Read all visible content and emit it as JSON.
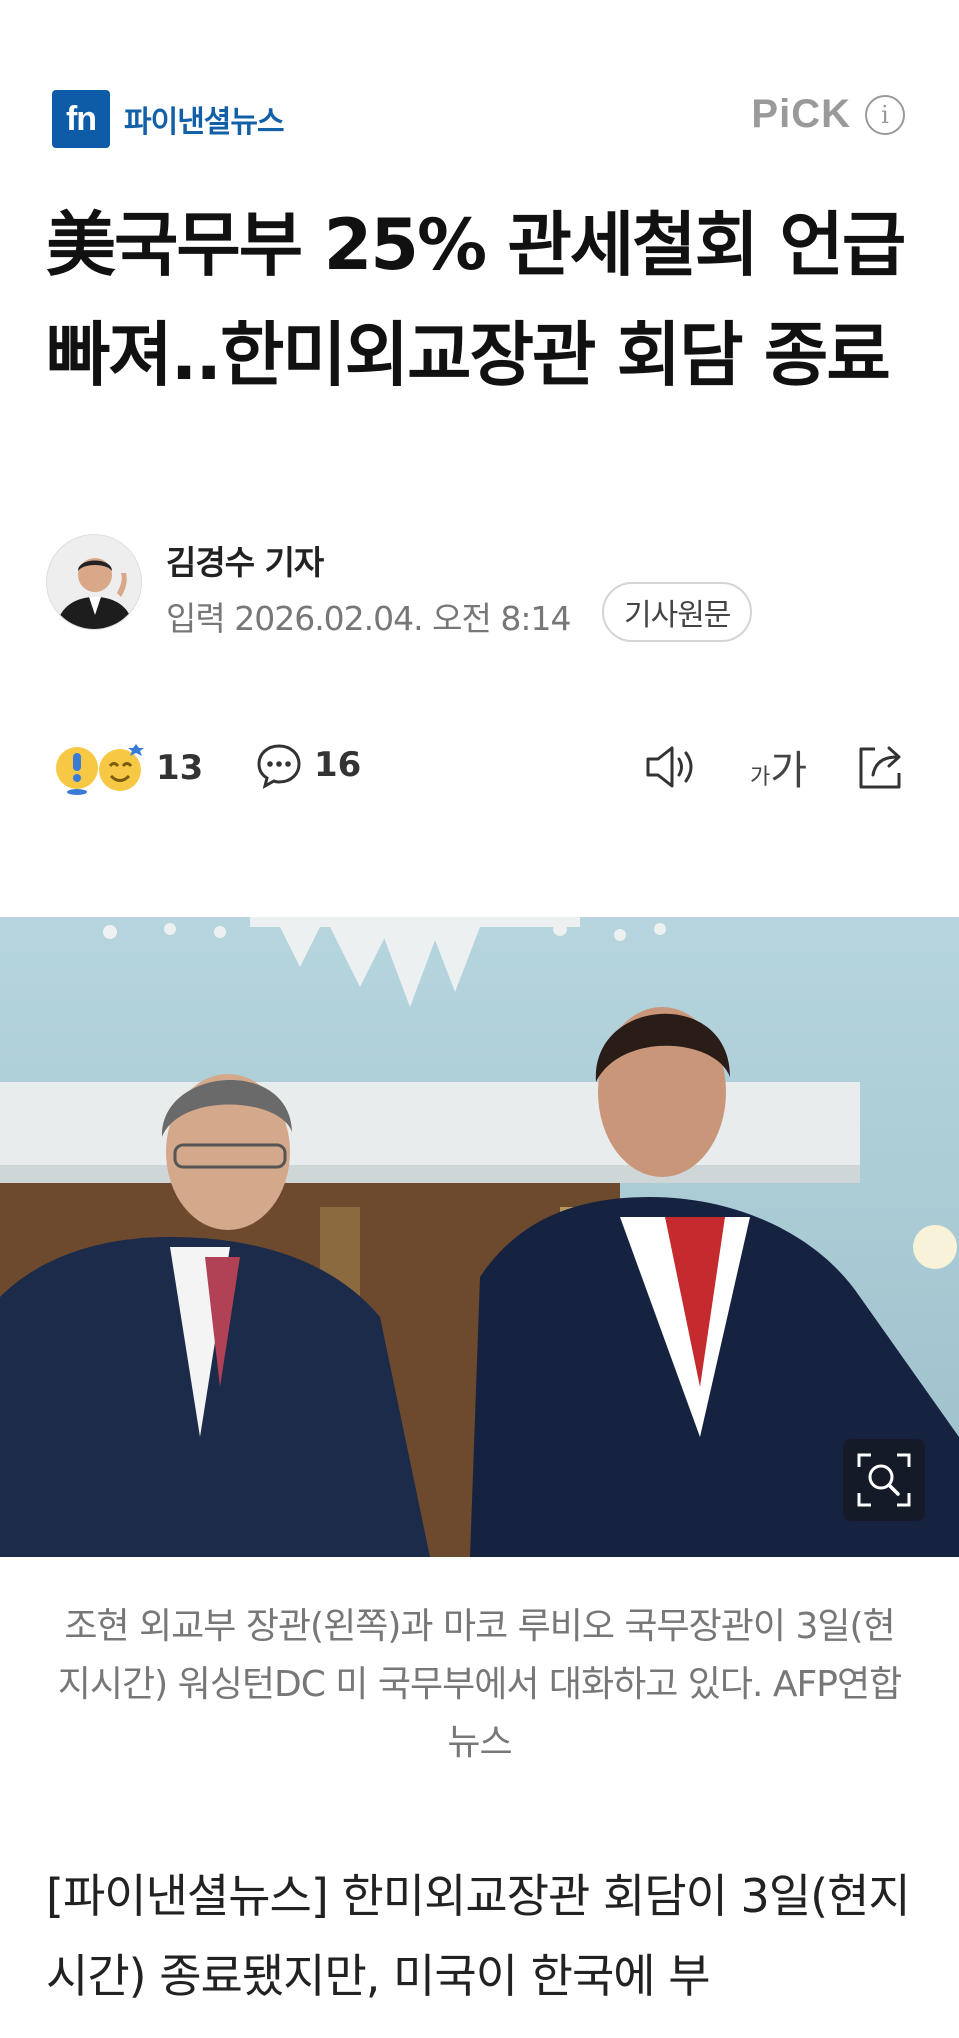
{
  "header": {
    "logo_mark": "fn",
    "logo_text": "파이낸셜뉴스",
    "pick_label": "PiCK",
    "info_icon": "info-circle-icon",
    "brand_color": "#0e5ba8"
  },
  "article": {
    "title": "美국무부 25% 관세철회 언급 빠져..한미외교장관 회담 종료",
    "reporter": "김경수 기자",
    "published": "입력 2026.02.04. 오전 8:14",
    "original_button": "기사원문"
  },
  "actions": {
    "reaction_count": "13",
    "comment_count": "16",
    "font_small": "가",
    "font_big": "가",
    "icons": [
      "surprise-emoji-icon",
      "happy-emoji-icon",
      "comment-icon",
      "speaker-icon",
      "font-size-icon",
      "share-icon"
    ]
  },
  "photo": {
    "caption": "조현 외교부 장관(왼쪽)과 마코 루비오 국무장관이 3일(현지시간) 워싱턴DC 미 국무부에서 대화하고 있다. AFP연합뉴스",
    "zoom_icon": "zoom-search-icon"
  },
  "body": {
    "text": "[파이낸셜뉴스] 한미외교장관 회담이 3일(현지시간) 종료됐지만, 미국이 한국에 부"
  }
}
